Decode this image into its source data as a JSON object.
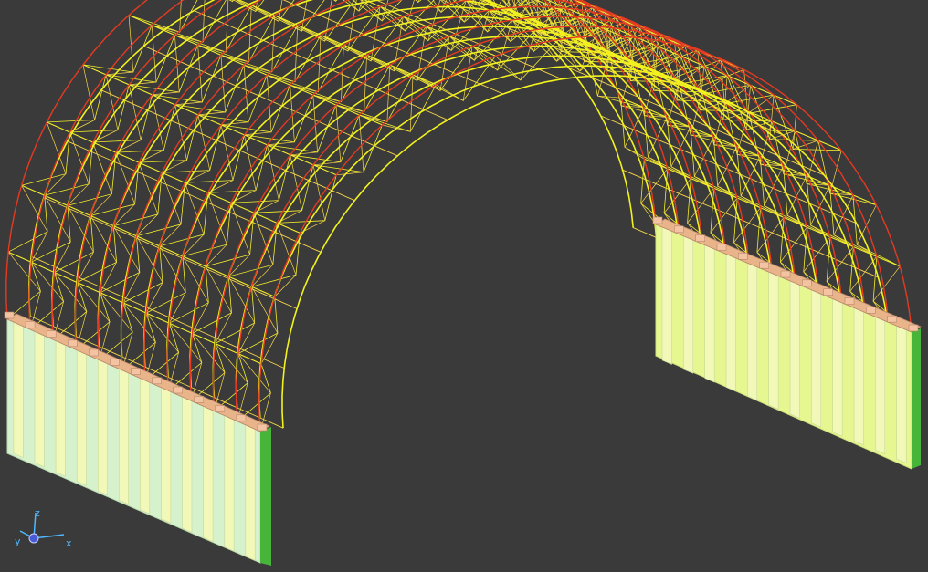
{
  "viewport": {
    "background": "#3a3a3a",
    "colors": {
      "arch_top_chord": "#e43a22",
      "web_member": "#f4ee2a",
      "web_member_light": "#f7d64a",
      "arch_bottom_chord": "#f2f21e",
      "wall_front_face": "#d6f2cc",
      "wall_right_face": "#e6f792",
      "wall_pillar": "#f2f8b8",
      "wall_end": "#47b53a",
      "ring_beam": "#e9b48a"
    },
    "structure": {
      "arch_ribs": 12,
      "truss_panels_per_rib": 16
    }
  },
  "axis_triad": {
    "x_label": "x",
    "y_label": "y",
    "z_label": "z",
    "x_color": "#4fb7ff",
    "y_color": "#4fb7ff",
    "z_color": "#4fb7ff",
    "origin_color": "#4a5bd6"
  }
}
